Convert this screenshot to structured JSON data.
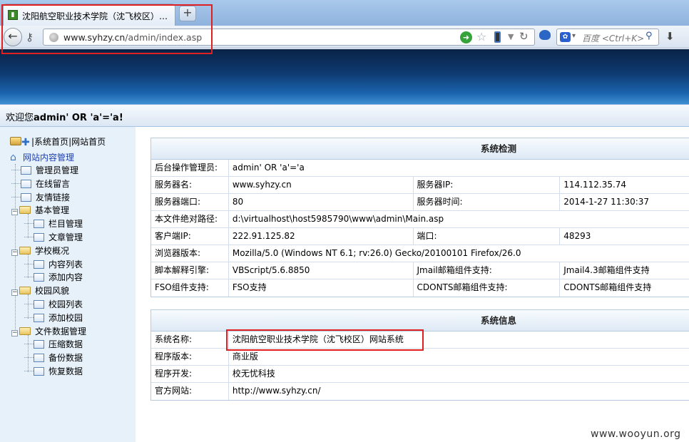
{
  "browser": {
    "tab_title": "沈阳航空职业技术学院（沈飞校区）网...",
    "new_tab": "+",
    "url_prefix": "www.syhzy.cn",
    "url_path": "/admin/index.asp",
    "search_placeholder": "百度 <Ctrl+K>"
  },
  "welcome": {
    "prefix": "欢迎您",
    "user": "admin' OR 'a'='a!"
  },
  "sidebar": {
    "top_links": [
      "系统首页",
      "网站首页"
    ],
    "top_sep": "|",
    "root": "网站内容管理",
    "items": [
      {
        "label": "管理员管理",
        "type": "doc",
        "level": 1
      },
      {
        "label": "在线留言",
        "type": "doc",
        "level": 1
      },
      {
        "label": "友情链接",
        "type": "doc",
        "level": 1
      },
      {
        "label": "基本管理",
        "type": "folder",
        "level": 1
      },
      {
        "label": "栏目管理",
        "type": "doc",
        "level": 2
      },
      {
        "label": "文章管理",
        "type": "doc",
        "level": 2
      },
      {
        "label": "学校概况",
        "type": "folder",
        "level": 1
      },
      {
        "label": "内容列表",
        "type": "doc",
        "level": 2
      },
      {
        "label": "添加内容",
        "type": "doc",
        "level": 2
      },
      {
        "label": "校园风貌",
        "type": "folder",
        "level": 1
      },
      {
        "label": "校园列表",
        "type": "doc",
        "level": 2
      },
      {
        "label": "添加校园",
        "type": "doc",
        "level": 2
      },
      {
        "label": "文件数据管理",
        "type": "folder",
        "level": 1
      },
      {
        "label": "压缩数据",
        "type": "doc",
        "level": 2
      },
      {
        "label": "备份数据",
        "type": "doc",
        "level": 2
      },
      {
        "label": "恢复数据",
        "type": "doc",
        "level": 2
      }
    ]
  },
  "system_check": {
    "title": "系统检测",
    "admin_label": "后台操作管理员:",
    "admin_value": "admin' OR 'a'='a",
    "server_name_label": "服务器名:",
    "server_name_value": "www.syhzy.cn",
    "server_ip_label": "服务器IP:",
    "server_ip_value": "114.112.35.74",
    "server_port_label": "服务器端口:",
    "server_port_value": "80",
    "server_time_label": "服务器时间:",
    "server_time_value": "2014-1-27 11:30:37",
    "path_label": "本文件绝对路径:",
    "path_value": "d:\\virtualhost\\host5985790\\www\\admin\\Main.asp",
    "client_ip_label": "客户端IP:",
    "client_ip_value": "222.91.125.82",
    "client_port_label": "端口:",
    "client_port_value": "48293",
    "browser_label": "浏览器版本:",
    "browser_value": "Mozilla/5.0 (Windows NT 6.1; rv:26.0) Gecko/20100101 Firefox/26.0",
    "script_label": "脚本解释引擎:",
    "script_value": "VBScript/5.6.8850",
    "jmail_label": "Jmail邮箱组件支持:",
    "jmail_value": "Jmail4.3邮箱组件支持",
    "fso_label": "FSO组件支持:",
    "fso_value": "FSO支持",
    "cdonts_label": "CDONTS邮箱组件支持:",
    "cdonts_value": "CDONTS邮箱组件支持"
  },
  "system_info": {
    "title": "系统信息",
    "name_label": "系统名称:",
    "name_value": "沈阳航空职业技术学院（沈飞校区）网站系统",
    "version_label": "程序版本:",
    "version_value": "商业版",
    "dev_label": "程序开发:",
    "dev_value": "校无忧科技",
    "site_label": "官方网站:",
    "site_value": "http://www.syhzy.cn/"
  },
  "watermark": "www.wooyun.org"
}
